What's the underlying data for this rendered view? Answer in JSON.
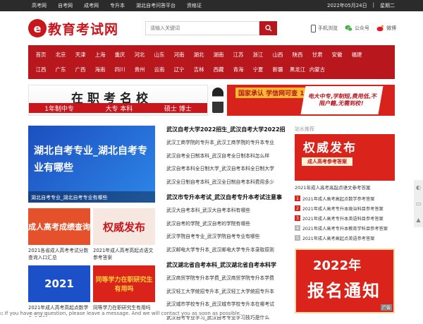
{
  "topbar": {
    "links": [
      "高考网",
      "自考网",
      "成考网",
      "专升本",
      "湖北自考问答平台",
      "资格证"
    ],
    "date": "2022年05月24日",
    "weekday": "星期二"
  },
  "header": {
    "logo_text": "教育考试网",
    "search_placeholder": "请输入关键词",
    "icons": [
      "手机浏览",
      "公众号",
      "微博"
    ]
  },
  "nav": {
    "row1": [
      "首页",
      "北京",
      "天津",
      "上海",
      "重庆",
      "河北",
      "山东",
      "河南",
      "湖北",
      "湖南",
      "江苏",
      "浙江",
      "山西",
      "陕西",
      "甘肃",
      "安徽",
      "福建"
    ],
    "row2": [
      "江西",
      "广东",
      "广西",
      "海南",
      "四川",
      "贵州",
      "云南",
      "辽宁",
      "吉林",
      "西藏",
      "青海",
      "宁夏",
      "新疆",
      "黑龙江",
      "内蒙古"
    ]
  },
  "banner": {
    "left_title": "在职考名校",
    "left_tags": [
      "1年制中专",
      "大专 本科",
      "硕士 博士"
    ],
    "right_tag": "国家承认 学信网可查 1年制 中专速取",
    "right_sub": "电大中专,学制短,费用低,不限户籍,无需到校!"
  },
  "featured": {
    "title": "湖北自考专业_湖北自考专业有哪些",
    "caption": "湖北自考专业_湖北自考专业有哪些"
  },
  "cards": [
    {
      "img": "成人高考成绩查询",
      "caption": "2021各省成人高考考试分数查询入口汇总"
    },
    {
      "img": "权威发布",
      "caption": "2021年成人高考高起点语文参考答案"
    },
    {
      "img": "2021",
      "caption": "2021年成人高考高起点数学参考答案"
    },
    {
      "img": "同等学力在职研究生有用吗",
      "caption": "同等学力在职研究生有用吗"
    }
  ],
  "mid": {
    "sec1_title": "武汉自考大学2022招生_武汉自考大学2022招",
    "sec1_items": [
      "武汉工商学院的专升本_武汉工商学院的专升本专业",
      "武汉自考全日制本科_武汉自考全日制本科怎么样",
      "武汉自考本科全日制大学_武汉自考本科全日制大学",
      "武汉全日制自考本科_武汉全日制自考本科费用多少"
    ],
    "sec2_title": "武汉市专升本考试_武汉自考专升本考试注意事",
    "sec2_items": [
      "武汉大自考本科_武汉大自考本科有哪些",
      "武汉自考的学院_武汉自考的学院有哪些",
      "武汉学院自考专业_武汉学院自考专业有哪些",
      "武汉邮电大学专升本_武汉邮电大学专升本录取原则"
    ],
    "sec3_title": "武汉湖北省自考本科_武汉湖北省自考本科学",
    "sec3_items": [
      "武汉商贸学院专升本学费_武汉商贸学院专升本学费",
      "武汉轻工大学统招专升本_武汉轻工大学统招专升本",
      "武汉城市学校专升本_武汉城市学校专升本在哪考试",
      "武汉自考专业学习_武汉自考专业学习技巧是什么"
    ]
  },
  "right": {
    "title": "站长推荐",
    "banner_title": "权威发布",
    "banner_sub": "成人高考参考答案",
    "caption": "2021年成人高考高起点语文参考答案",
    "ranks": [
      "2021年成人高考高起点数学参考答案",
      "2021年成人高考专升本政治科目参考答案",
      "2021年成人高考专升本英语科目参考答案",
      "2021年成人高考专升本教育学科目参考答案",
      "2021年成人高考高起点英语参考答案"
    ],
    "banner2_year": "2022年",
    "banner2_text": "报名通知",
    "ad_label": "广告"
  },
  "float_msg": "If you have any question, please leave a message. And we will contact you as soon as possible.",
  "colors": {
    "brand_red": "#b8171d",
    "topbar": "#2b2b2b"
  }
}
